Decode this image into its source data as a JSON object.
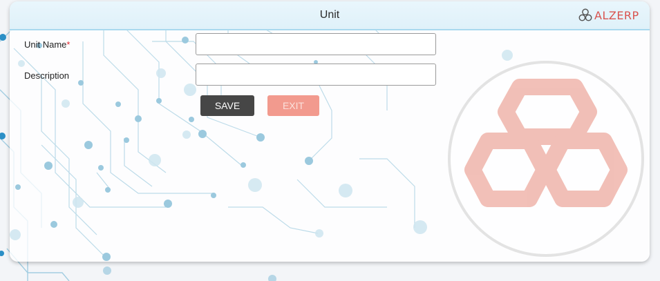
{
  "window": {
    "title": "Unit"
  },
  "brand": {
    "logo_text": "ALZERP",
    "accent_color": "#d9534f"
  },
  "form": {
    "unit_name_label": "Unit Name",
    "required_marker": "*",
    "unit_name_value": "",
    "description_label": "Description",
    "description_value": ""
  },
  "buttons": {
    "save_label": "SAVE",
    "exit_label": "EXIT"
  },
  "colors": {
    "title_bar": "#e9f6fc",
    "save_button": "#464646",
    "exit_button": "#f29a8e",
    "required": "#e0262d"
  },
  "icons": [
    "alzerp-logo-icon",
    "alzerp-watermark-icon",
    "circuit-background"
  ]
}
